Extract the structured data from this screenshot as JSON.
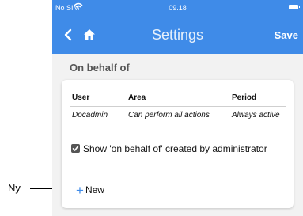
{
  "callout": {
    "label": "Ny"
  },
  "status_bar": {
    "carrier": "No SIM",
    "time": "09.18"
  },
  "nav": {
    "title": "Settings",
    "save_label": "Save"
  },
  "section": {
    "title": "On behalf of"
  },
  "table": {
    "headers": [
      "User",
      "Area",
      "Period"
    ],
    "rows": [
      {
        "user": "Docadmin",
        "area": "Can perform all actions",
        "period": "Always active"
      }
    ]
  },
  "checkbox": {
    "label": "Show 'on behalf of' created by administrator",
    "checked": true
  },
  "new_button": {
    "label": "New"
  },
  "colors": {
    "accent": "#3f8be8",
    "background": "#f2f2f2"
  },
  "icons": [
    "wifi-icon",
    "battery-icon",
    "back-icon",
    "home-icon",
    "checkbox-checked-icon",
    "plus-icon"
  ]
}
